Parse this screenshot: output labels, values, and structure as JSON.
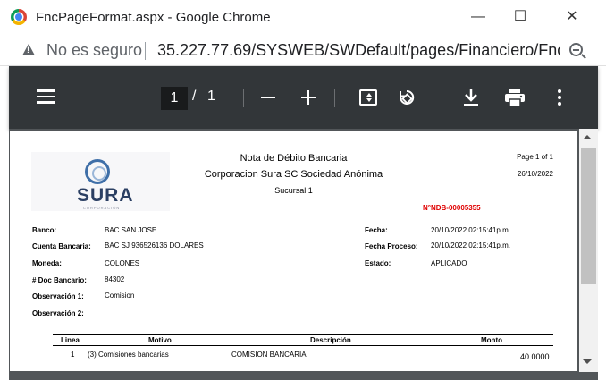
{
  "window": {
    "title": "FncPageFormat.aspx - Google Chrome",
    "minimize": "—",
    "maximize": "☐",
    "close": "✕"
  },
  "address": {
    "security": "No es seguro",
    "url": "35.227.77.69/SYSWEB/SWDefault/pages/Financiero/Fnc..."
  },
  "pdf_toolbar": {
    "current_page": "1",
    "separator": "/",
    "total_pages": "1"
  },
  "document": {
    "title": "Nota de Débito Bancaria",
    "company": "Corporacion Sura SC Sociedad Anónima",
    "branch": "Sucursal 1",
    "page_info": "Page 1 of 1",
    "date": "26/10/2022",
    "number": "N°NDB-00005355",
    "logo_text": "SURA",
    "logo_sub": "CORPORACIÓN",
    "fields_left": [
      {
        "label": "Banco:",
        "value": "BAC SAN JOSE"
      },
      {
        "label": "Cuenta Bancaria:",
        "value": "BAC  SJ 936526136 DOLARES"
      },
      {
        "label": "Moneda:",
        "value": "COLONES"
      },
      {
        "label": "# Doc Bancario:",
        "value": "84302"
      },
      {
        "label": "Observación 1:",
        "value": "Comision"
      },
      {
        "label": "Observación 2:",
        "value": ""
      }
    ],
    "fields_right": [
      {
        "label": "Fecha:",
        "value": "20/10/2022  02:15:41p.m."
      },
      {
        "label": "Fecha Proceso:",
        "value": "20/10/2022  02:15:41p.m."
      },
      {
        "label": "Estado:",
        "value": "APLICADO"
      }
    ],
    "table": {
      "headers": [
        "Linea",
        "Motivo",
        "Descripción",
        "Monto"
      ],
      "rows": [
        {
          "linea": "1",
          "motivo": "(3) Comisiones bancarias",
          "descripcion": "COMISION BANCARIA",
          "monto": "40.0000"
        }
      ]
    }
  }
}
